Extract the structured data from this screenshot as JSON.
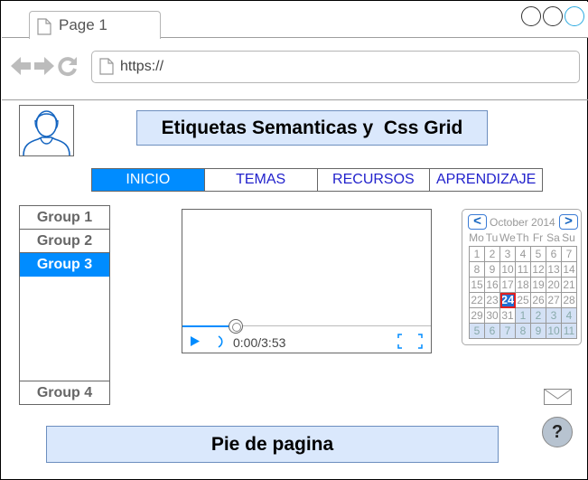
{
  "browser": {
    "tab_title": "Page 1",
    "url": "https://"
  },
  "header": {
    "title": "Etiquetas Semanticas y  Css Grid"
  },
  "menu": {
    "items": [
      {
        "label": "INICIO",
        "selected": true
      },
      {
        "label": "TEMAS",
        "selected": false
      },
      {
        "label": "RECURSOS",
        "selected": false
      },
      {
        "label": "APRENDIZAJE",
        "selected": false
      }
    ]
  },
  "accordion": {
    "items": [
      {
        "label": "Group 1",
        "selected": false
      },
      {
        "label": "Group 2",
        "selected": false
      },
      {
        "label": "Group 3",
        "selected": true
      },
      {
        "label": "Group 4",
        "selected": false
      }
    ]
  },
  "video": {
    "time": "0:00/3:53"
  },
  "calendar": {
    "month_label": "October 2014",
    "prev_label": "<",
    "next_label": ">",
    "weekdays": [
      "Mo",
      "Tu",
      "We",
      "Th",
      "Fr",
      "Sa",
      "Su"
    ],
    "selected_day": "24",
    "weeks": [
      [
        "1",
        "2",
        "3",
        "4",
        "5",
        "6",
        "7"
      ],
      [
        "8",
        "9",
        "10",
        "11",
        "12",
        "13",
        "14"
      ],
      [
        "15",
        "16",
        "17",
        "18",
        "19",
        "20",
        "21"
      ],
      [
        "22",
        "23",
        "24",
        "25",
        "26",
        "27",
        "28"
      ],
      [
        "29",
        "30",
        "31",
        "1",
        "2",
        "3",
        "4"
      ],
      [
        "5",
        "6",
        "7",
        "8",
        "9",
        "10",
        "11"
      ]
    ],
    "other_month_from_index": 31
  },
  "help": {
    "label": "?"
  },
  "footer": {
    "text": "Pie de pagina"
  },
  "colors": {
    "accent": "#008cff",
    "header_fill": "#dae8fc",
    "header_border": "#6c8ebf",
    "menu_text": "#2222cc"
  }
}
